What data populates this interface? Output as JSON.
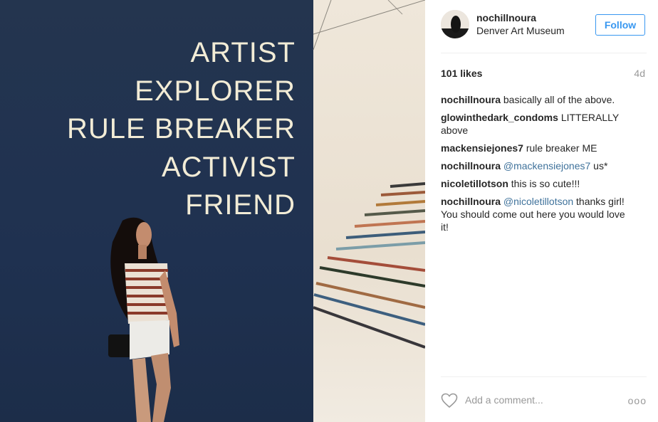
{
  "post": {
    "username": "nochillnoura",
    "location": "Denver Art Museum",
    "follow_label": "Follow",
    "likes": "101 likes",
    "age": "4d",
    "comments": [
      {
        "user": "nochillnoura",
        "mention": "",
        "text": "basically all of the above."
      },
      {
        "user": "glowinthedark_condoms",
        "mention": "",
        "text": "LITTERALLY above"
      },
      {
        "user": "mackensiejones7",
        "mention": "",
        "text": "rule breaker ME"
      },
      {
        "user": "nochillnoura",
        "mention": "@mackensiejones7",
        "text": "us*"
      },
      {
        "user": "nicoletillotson",
        "mention": "",
        "text": "this is so cute!!!"
      },
      {
        "user": "nochillnoura",
        "mention": "@nicoletillotson",
        "text": "thanks girl! You should come out here you would love it!"
      }
    ],
    "add_comment_placeholder": "Add a comment...",
    "more_label": "ooo"
  },
  "photo": {
    "wall_text": [
      "ARTIST",
      "EXPLORER",
      "RULE BREAKER",
      "ACTIVIST",
      "FRIEND"
    ]
  },
  "colors": {
    "accent": "#3897f0",
    "mention": "#3f729b",
    "wall": "#24354f",
    "wall_text": "#f2ecd6"
  }
}
